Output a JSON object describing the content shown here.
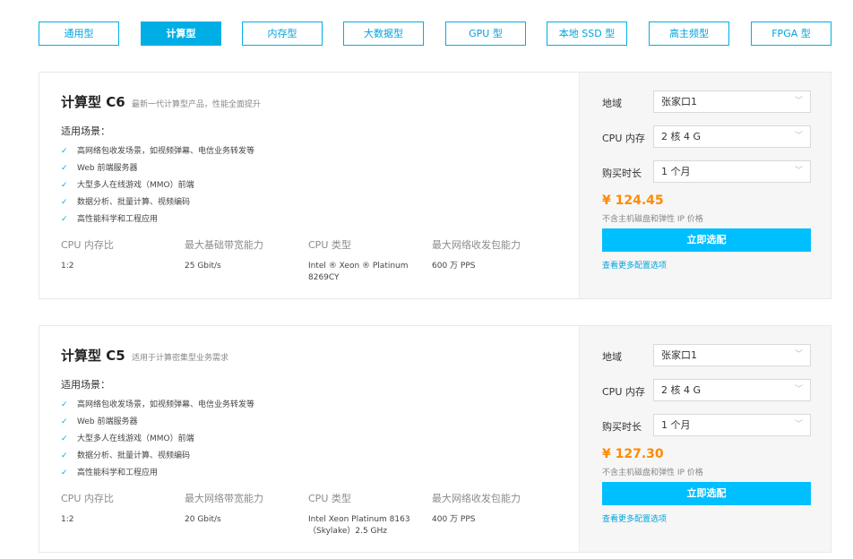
{
  "tabs": [
    {
      "label": "通用型",
      "active": false
    },
    {
      "label": "计算型",
      "active": true
    },
    {
      "label": "内存型",
      "active": false
    },
    {
      "label": "大数据型",
      "active": false
    },
    {
      "label": "GPU 型",
      "active": false
    },
    {
      "label": "本地 SSD 型",
      "active": false
    },
    {
      "label": "高主频型",
      "active": false
    },
    {
      "label": "FPGA 型",
      "active": false
    }
  ],
  "cards": [
    {
      "title": "计算型 C6",
      "subtitle": "最新一代计算型产品，性能全面提升",
      "scene_label": "适用场景：",
      "features": [
        "高网络包收发场景，如视频弹幕、电信业务转发等",
        "Web 前端服务器",
        "大型多人在线游戏（MMO）前端",
        "数据分析、批量计算、视频编码",
        "高性能科学和工程应用"
      ],
      "specs": [
        {
          "label": "CPU 内存比",
          "value": "1:2"
        },
        {
          "label": "最大基础带宽能力",
          "value": "25 Gbit/s"
        },
        {
          "label": "CPU 类型",
          "value": "Intel ® Xeon ® Platinum 8269CY"
        },
        {
          "label": "最大网络收发包能力",
          "value": "600 万 PPS"
        }
      ],
      "region_label": "地域",
      "region_value": "张家口1",
      "cpu_label": "CPU 内存",
      "cpu_value": "2 核 4 G",
      "duration_label": "购买时长",
      "duration_value": "1 个月",
      "price": "¥ 124.45",
      "price_note": "不含主机磁盘和弹性 IP 价格",
      "buy_label": "立即选配",
      "more_label": "查看更多配置选项"
    },
    {
      "title": "计算型 C5",
      "subtitle": "适用于计算密集型业务需求",
      "scene_label": "适用场景：",
      "features": [
        "高网络包收发场景，如视频弹幕、电信业务转发等",
        "Web 前端服务器",
        "大型多人在线游戏（MMO）前端",
        "数据分析、批量计算、视频编码",
        "高性能科学和工程应用"
      ],
      "specs": [
        {
          "label": "CPU 内存比",
          "value": "1:2"
        },
        {
          "label": "最大网络带宽能力",
          "value": "20 Gbit/s"
        },
        {
          "label": "CPU 类型",
          "value": "Intel Xeon Platinum 8163（Skylake）2.5 GHz"
        },
        {
          "label": "最大网络收发包能力",
          "value": "400 万 PPS"
        }
      ],
      "region_label": "地域",
      "region_value": "张家口1",
      "cpu_label": "CPU 内存",
      "cpu_value": "2 核 4 G",
      "duration_label": "购买时长",
      "duration_value": "1 个月",
      "price": "¥ 127.30",
      "price_note": "不含主机磁盘和弹性 IP 价格",
      "buy_label": "立即选配",
      "more_label": "查看更多配置选项"
    }
  ],
  "icons": {
    "check": "check-icon",
    "chevron": "chevron-down-icon"
  },
  "colors": {
    "accent": "#00aee6",
    "button": "#00bfff",
    "price": "#ff8a00",
    "panel": "#f6f6f6"
  }
}
